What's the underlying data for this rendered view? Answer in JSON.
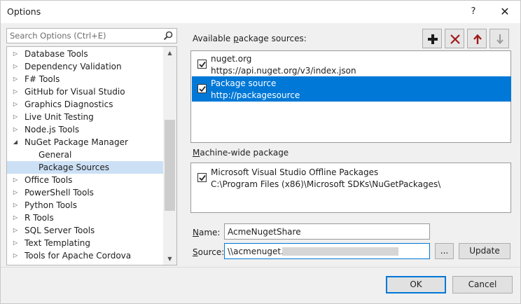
{
  "window": {
    "title": "Options",
    "help_glyph": "?",
    "close_glyph": "✕"
  },
  "search": {
    "placeholder": "Search Options (Ctrl+E)"
  },
  "tree": {
    "items": [
      {
        "label": "Database Tools",
        "level": 0,
        "expandable": true
      },
      {
        "label": "Dependency Validation",
        "level": 0,
        "expandable": true
      },
      {
        "label": "F# Tools",
        "level": 0,
        "expandable": true
      },
      {
        "label": "GitHub for Visual Studio",
        "level": 0,
        "expandable": true
      },
      {
        "label": "Graphics Diagnostics",
        "level": 0,
        "expandable": true
      },
      {
        "label": "Live Unit Testing",
        "level": 0,
        "expandable": true
      },
      {
        "label": "Node.js Tools",
        "level": 0,
        "expandable": true
      },
      {
        "label": "NuGet Package Manager",
        "level": 0,
        "expandable": true,
        "expanded": true
      },
      {
        "label": "General",
        "level": 1,
        "expandable": false
      },
      {
        "label": "Package Sources",
        "level": 1,
        "expandable": false,
        "selected": true
      },
      {
        "label": "Office Tools",
        "level": 0,
        "expandable": true
      },
      {
        "label": "PowerShell Tools",
        "level": 0,
        "expandable": true
      },
      {
        "label": "Python Tools",
        "level": 0,
        "expandable": true
      },
      {
        "label": "R Tools",
        "level": 0,
        "expandable": true
      },
      {
        "label": "SQL Server Tools",
        "level": 0,
        "expandable": true
      },
      {
        "label": "Text Templating",
        "level": 0,
        "expandable": true
      },
      {
        "label": "Tools for Apache Cordova",
        "level": 0,
        "expandable": true
      }
    ]
  },
  "available": {
    "label_pre": "Available ",
    "label_key": "p",
    "label_post": "ackage sources:",
    "sources": [
      {
        "name": "nuget.org",
        "url": "https://api.nuget.org/v3/index.json",
        "checked": true,
        "selected": false
      },
      {
        "name": "Package source",
        "url": "http://packagesource",
        "checked": true,
        "selected": true
      }
    ]
  },
  "toolbar": {
    "add_icon": "plus-icon",
    "remove_icon": "x-icon",
    "up_icon": "arrow-up-icon",
    "down_icon": "arrow-down-icon"
  },
  "machine_wide": {
    "label_key": "M",
    "label_post": "achine-wide package",
    "sources": [
      {
        "name": "Microsoft Visual Studio Offline Packages",
        "url": "C:\\Program Files (x86)\\Microsoft SDKs\\NuGetPackages\\",
        "checked": true
      }
    ]
  },
  "form": {
    "name_label_key": "N",
    "name_label_post": "ame:",
    "name_value": "AcmeNugetShare",
    "source_label_key": "S",
    "source_label_post": "ource:",
    "source_value": "\\\\acmenuget.",
    "browse_label": "...",
    "update_label": "Update"
  },
  "footer": {
    "ok_label": "OK",
    "cancel_label": "Cancel"
  },
  "colors": {
    "selection": "#0078d7",
    "tree_selection": "#cce0f5",
    "remove_icon": "#a01a1a",
    "arrow_up": "#a01a1a",
    "arrow_down_disabled": "#9a9a9a"
  }
}
